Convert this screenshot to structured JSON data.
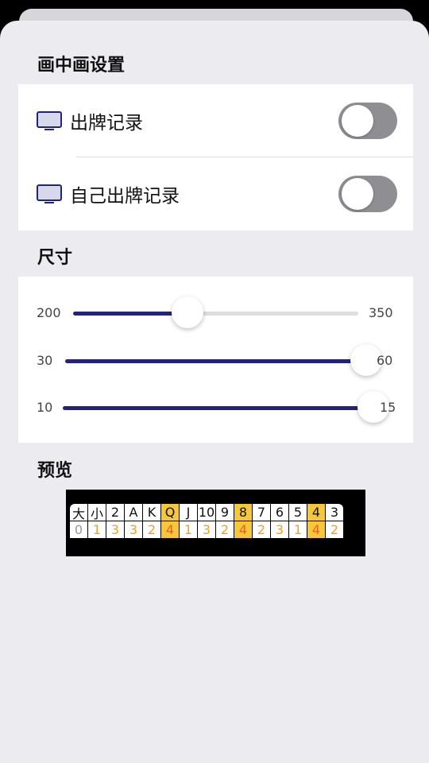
{
  "sections": {
    "pip": "画中画设置",
    "size": "尺寸",
    "preview": "预览"
  },
  "toggles": [
    {
      "label": "出牌记录",
      "icon": "monitor-icon",
      "on": false
    },
    {
      "label": "自己出牌记录",
      "icon": "monitor-icon",
      "on": false
    }
  ],
  "sliders": [
    {
      "min": "200",
      "max": "350",
      "value_fraction": 0.4
    },
    {
      "min": "30",
      "max": "60",
      "value_fraction": 1.0
    },
    {
      "min": "10",
      "max": "15",
      "value_fraction": 1.0
    }
  ],
  "preview": {
    "cards": [
      "大",
      "小",
      "2",
      "A",
      "K",
      "Q",
      "J",
      "10",
      "9",
      "8",
      "7",
      "6",
      "5",
      "4",
      "3"
    ],
    "counts": [
      "0",
      "1",
      "3",
      "3",
      "2",
      "4",
      "1",
      "3",
      "2",
      "4",
      "2",
      "3",
      "1",
      "4",
      "2"
    ],
    "highlight_color": "#f5c83b",
    "count_color": "#f0a020"
  },
  "colors": {
    "accent": "#24237a",
    "toggle_off": "#8e8e93",
    "background": "#ebebf0"
  }
}
